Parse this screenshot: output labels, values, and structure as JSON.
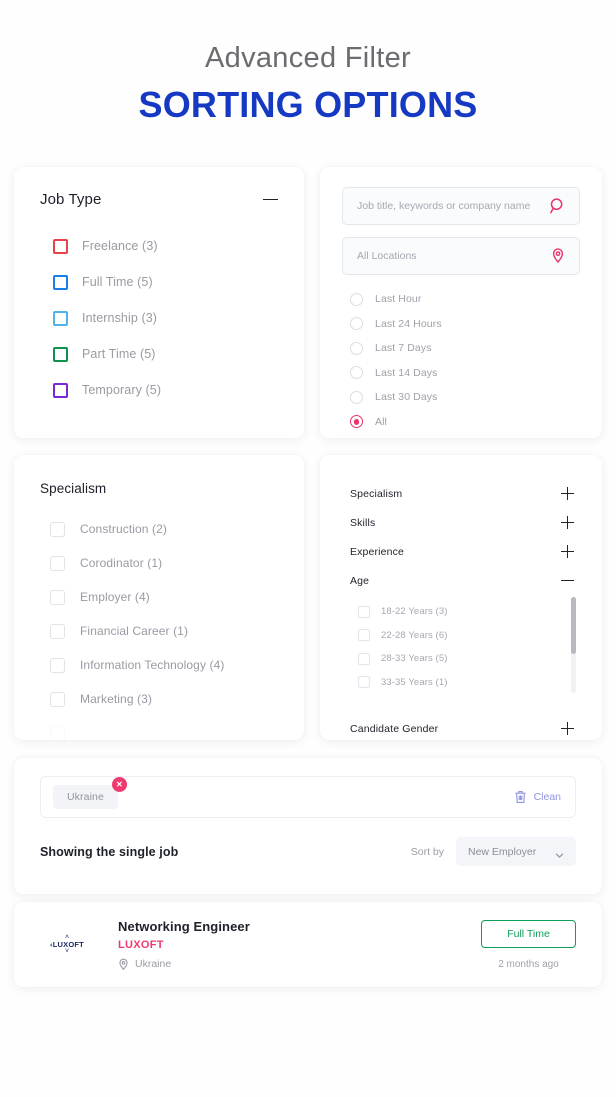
{
  "header": {
    "subtitle": "Advanced Filter",
    "title": "SORTING OPTIONS",
    "accent_color": "#1639c4"
  },
  "job_type_panel": {
    "title": "Job Type",
    "toggle_icon": "minus-icon",
    "items": [
      {
        "label": "Freelance (3)",
        "color": "#e8414a",
        "checked": false
      },
      {
        "label": "Full Time (5)",
        "color": "#1a7de8",
        "checked": false
      },
      {
        "label": "Internship (3)",
        "color": "#4fb2e8",
        "checked": false
      },
      {
        "label": "Part Time (5)",
        "color": "#11914e",
        "checked": false
      },
      {
        "label": "Temporary (5)",
        "color": "#7a27d6",
        "checked": false
      }
    ]
  },
  "search_panel": {
    "keyword_input": {
      "value": "",
      "placeholder": "Job title, keywords or company name",
      "icon": "search-icon"
    },
    "location_input": {
      "value": "",
      "placeholder": "All Locations",
      "icon": "location-pin-icon"
    },
    "accent_color": "#e8336b",
    "date_options": [
      {
        "label": "Last Hour",
        "selected": false
      },
      {
        "label": "Last 24 Hours",
        "selected": false
      },
      {
        "label": "Last 7 Days",
        "selected": false
      },
      {
        "label": "Last 14 Days",
        "selected": false
      },
      {
        "label": "Last 30 Days",
        "selected": false
      },
      {
        "label": "All",
        "selected": true
      }
    ]
  },
  "specialism_panel": {
    "title": "Specialism",
    "items": [
      {
        "label": "Construction (2)",
        "checked": false
      },
      {
        "label": "Corodinator (1)",
        "checked": false
      },
      {
        "label": "Employer (4)",
        "checked": false
      },
      {
        "label": "Financial Career (1)",
        "checked": false
      },
      {
        "label": "Information Technology (4)",
        "checked": false
      },
      {
        "label": "Marketing (3)",
        "checked": false
      },
      {
        "label": "",
        "checked": false
      }
    ]
  },
  "accordion_panel": {
    "sections": [
      {
        "label": "Specialism",
        "expanded": false,
        "sign": "plus-icon"
      },
      {
        "label": "Skills",
        "expanded": false,
        "sign": "plus-icon"
      },
      {
        "label": "Experience",
        "expanded": false,
        "sign": "plus-icon"
      },
      {
        "label": "Age",
        "expanded": true,
        "sign": "minus-icon"
      }
    ],
    "age_items": [
      {
        "label": "18-22 Years (3)",
        "checked": false
      },
      {
        "label": "22-28 Years (6)",
        "checked": false
      },
      {
        "label": "28-33 Years (5)",
        "checked": false
      },
      {
        "label": "33-35 Years (1)",
        "checked": false
      }
    ],
    "last_section": {
      "label": "Candidate Gender",
      "expanded": false,
      "sign": "plus-icon"
    }
  },
  "results_panel": {
    "active_filters": [
      {
        "label": "Ukraine",
        "remove_icon": "close-icon"
      }
    ],
    "clean_button": {
      "label": "Clean",
      "icon": "trash-icon",
      "color": "#8f94df"
    },
    "showing_text": "Showing the single job",
    "sort": {
      "label": "Sort by",
      "value": "New Employer",
      "icon": "chevron-down-icon"
    }
  },
  "job_listing": {
    "logo": {
      "text": "LUXOFT",
      "prefix": "‹",
      "color": "#1b2a63"
    },
    "title": "Networking Engineer",
    "company": "LUXOFT",
    "company_color": "#ee3a6e",
    "location": "Ukraine",
    "location_icon": "location-pin-icon",
    "badge": {
      "label": "Full Time",
      "color": "#0f9d58"
    },
    "posted": "2 months ago"
  }
}
